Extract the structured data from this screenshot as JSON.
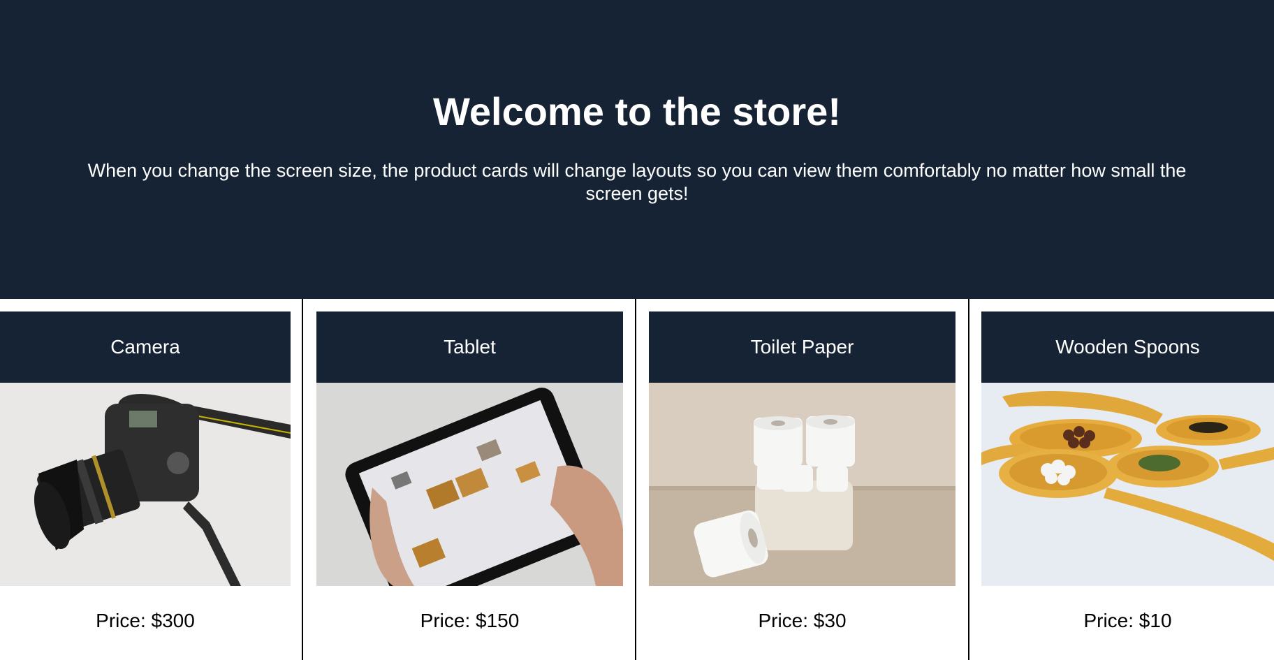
{
  "hero": {
    "title": "Welcome to the store!",
    "subtitle": "When you change the screen size, the product cards will change layouts so you can view them comfortably no matter how small the screen gets!",
    "background_color": "#152334"
  },
  "products": [
    {
      "name": "Camera",
      "price": "Price: $300",
      "image": "camera-image"
    },
    {
      "name": "Tablet",
      "price": "Price: $150",
      "image": "tablet-image"
    },
    {
      "name": "Toilet Paper",
      "price": "Price: $30",
      "image": "toilet-paper-image"
    },
    {
      "name": "Wooden Spoons",
      "price": "Price: $10",
      "image": "wooden-spoons-image"
    }
  ]
}
